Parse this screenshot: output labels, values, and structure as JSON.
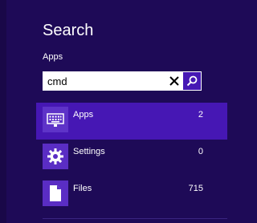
{
  "search_pane": {
    "title": "Search",
    "scope": "Apps",
    "query": "cmd",
    "clear_icon": "close-icon",
    "search_icon": "search-icon"
  },
  "results": [
    {
      "label": "Apps",
      "count": "2",
      "icon": "keyboard-icon",
      "selected": true
    },
    {
      "label": "Settings",
      "count": "0",
      "icon": "gear-icon",
      "selected": false
    },
    {
      "label": "Files",
      "count": "715",
      "icon": "file-icon",
      "selected": false
    }
  ],
  "colors": {
    "background": "#1e0a57",
    "accent": "#4617b4",
    "tile": "#5a2dc4"
  }
}
